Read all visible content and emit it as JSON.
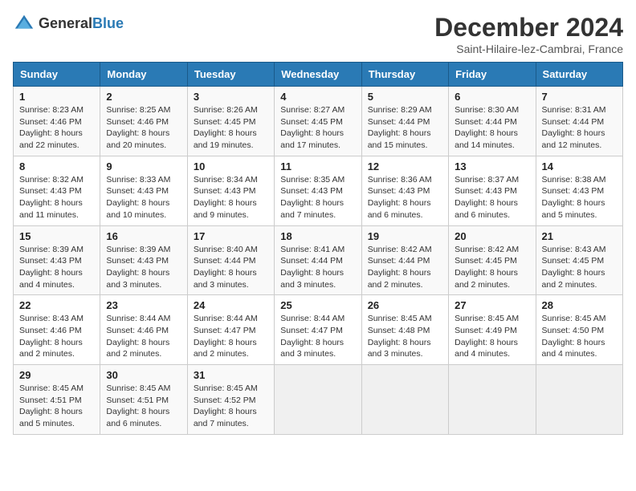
{
  "header": {
    "logo_general": "General",
    "logo_blue": "Blue",
    "month_title": "December 2024",
    "subtitle": "Saint-Hilaire-lez-Cambrai, France"
  },
  "days_of_week": [
    "Sunday",
    "Monday",
    "Tuesday",
    "Wednesday",
    "Thursday",
    "Friday",
    "Saturday"
  ],
  "weeks": [
    [
      {
        "day": "1",
        "sunrise": "8:23 AM",
        "sunset": "4:46 PM",
        "daylight": "8 hours and 22 minutes."
      },
      {
        "day": "2",
        "sunrise": "8:25 AM",
        "sunset": "4:46 PM",
        "daylight": "8 hours and 20 minutes."
      },
      {
        "day": "3",
        "sunrise": "8:26 AM",
        "sunset": "4:45 PM",
        "daylight": "8 hours and 19 minutes."
      },
      {
        "day": "4",
        "sunrise": "8:27 AM",
        "sunset": "4:45 PM",
        "daylight": "8 hours and 17 minutes."
      },
      {
        "day": "5",
        "sunrise": "8:29 AM",
        "sunset": "4:44 PM",
        "daylight": "8 hours and 15 minutes."
      },
      {
        "day": "6",
        "sunrise": "8:30 AM",
        "sunset": "4:44 PM",
        "daylight": "8 hours and 14 minutes."
      },
      {
        "day": "7",
        "sunrise": "8:31 AM",
        "sunset": "4:44 PM",
        "daylight": "8 hours and 12 minutes."
      }
    ],
    [
      {
        "day": "8",
        "sunrise": "8:32 AM",
        "sunset": "4:43 PM",
        "daylight": "8 hours and 11 minutes."
      },
      {
        "day": "9",
        "sunrise": "8:33 AM",
        "sunset": "4:43 PM",
        "daylight": "8 hours and 10 minutes."
      },
      {
        "day": "10",
        "sunrise": "8:34 AM",
        "sunset": "4:43 PM",
        "daylight": "8 hours and 9 minutes."
      },
      {
        "day": "11",
        "sunrise": "8:35 AM",
        "sunset": "4:43 PM",
        "daylight": "8 hours and 7 minutes."
      },
      {
        "day": "12",
        "sunrise": "8:36 AM",
        "sunset": "4:43 PM",
        "daylight": "8 hours and 6 minutes."
      },
      {
        "day": "13",
        "sunrise": "8:37 AM",
        "sunset": "4:43 PM",
        "daylight": "8 hours and 6 minutes."
      },
      {
        "day": "14",
        "sunrise": "8:38 AM",
        "sunset": "4:43 PM",
        "daylight": "8 hours and 5 minutes."
      }
    ],
    [
      {
        "day": "15",
        "sunrise": "8:39 AM",
        "sunset": "4:43 PM",
        "daylight": "8 hours and 4 minutes."
      },
      {
        "day": "16",
        "sunrise": "8:39 AM",
        "sunset": "4:43 PM",
        "daylight": "8 hours and 3 minutes."
      },
      {
        "day": "17",
        "sunrise": "8:40 AM",
        "sunset": "4:44 PM",
        "daylight": "8 hours and 3 minutes."
      },
      {
        "day": "18",
        "sunrise": "8:41 AM",
        "sunset": "4:44 PM",
        "daylight": "8 hours and 3 minutes."
      },
      {
        "day": "19",
        "sunrise": "8:42 AM",
        "sunset": "4:44 PM",
        "daylight": "8 hours and 2 minutes."
      },
      {
        "day": "20",
        "sunrise": "8:42 AM",
        "sunset": "4:45 PM",
        "daylight": "8 hours and 2 minutes."
      },
      {
        "day": "21",
        "sunrise": "8:43 AM",
        "sunset": "4:45 PM",
        "daylight": "8 hours and 2 minutes."
      }
    ],
    [
      {
        "day": "22",
        "sunrise": "8:43 AM",
        "sunset": "4:46 PM",
        "daylight": "8 hours and 2 minutes."
      },
      {
        "day": "23",
        "sunrise": "8:44 AM",
        "sunset": "4:46 PM",
        "daylight": "8 hours and 2 minutes."
      },
      {
        "day": "24",
        "sunrise": "8:44 AM",
        "sunset": "4:47 PM",
        "daylight": "8 hours and 2 minutes."
      },
      {
        "day": "25",
        "sunrise": "8:44 AM",
        "sunset": "4:47 PM",
        "daylight": "8 hours and 3 minutes."
      },
      {
        "day": "26",
        "sunrise": "8:45 AM",
        "sunset": "4:48 PM",
        "daylight": "8 hours and 3 minutes."
      },
      {
        "day": "27",
        "sunrise": "8:45 AM",
        "sunset": "4:49 PM",
        "daylight": "8 hours and 4 minutes."
      },
      {
        "day": "28",
        "sunrise": "8:45 AM",
        "sunset": "4:50 PM",
        "daylight": "8 hours and 4 minutes."
      }
    ],
    [
      {
        "day": "29",
        "sunrise": "8:45 AM",
        "sunset": "4:51 PM",
        "daylight": "8 hours and 5 minutes."
      },
      {
        "day": "30",
        "sunrise": "8:45 AM",
        "sunset": "4:51 PM",
        "daylight": "8 hours and 6 minutes."
      },
      {
        "day": "31",
        "sunrise": "8:45 AM",
        "sunset": "4:52 PM",
        "daylight": "8 hours and 7 minutes."
      },
      null,
      null,
      null,
      null
    ]
  ],
  "labels": {
    "sunrise": "Sunrise:",
    "sunset": "Sunset:",
    "daylight": "Daylight:"
  }
}
